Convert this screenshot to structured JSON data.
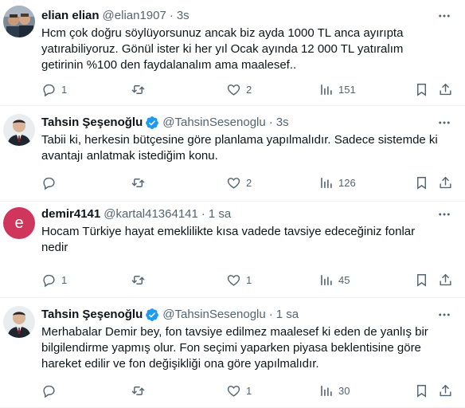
{
  "tweets": [
    {
      "name": "elian elian",
      "handle": "@elian1907",
      "time": "3s",
      "verified": false,
      "lines": [
        "Hcm çok doğru söylüyorsunuz ancak biz ayda 1000 TL anca ayırıpta",
        "yatırabiliyoruz. Gönül ister ki her yıl Ocak ayında 12 000 TL yatıralım",
        "getirinin %100 den faydalanalım ama maalesef.."
      ],
      "replies": "1",
      "retweets": "",
      "likes": "2",
      "views": "151"
    },
    {
      "name": "Tahsin Şeşenoğlu",
      "handle": "@TahsinSesenoglu",
      "time": "3s",
      "verified": true,
      "lines": [
        "Tabii ki, herkesin bütçesine göre planlama yapılmalıdır. Sadece sistemde ki",
        "avantajı anlatmak istediğim konu."
      ],
      "replies": "",
      "retweets": "",
      "likes": "2",
      "views": "126"
    },
    {
      "name": "demir4141",
      "handle": "@kartal41364141",
      "time": "1 sa",
      "verified": false,
      "avatar_letter": "e",
      "lines": [
        "Hocam Türkiye hayat emeklilikte kısa vadede tavsiye edeceğiniz fonlar",
        "nedir"
      ],
      "replies": "1",
      "retweets": "",
      "likes": "1",
      "views": "45"
    },
    {
      "name": "Tahsin Şeşenoğlu",
      "handle": "@TahsinSesenoglu",
      "time": "1 sa",
      "verified": true,
      "lines": [
        "Merhabalar Demir bey, fon tavsiye edilmez maalesef ki eden de yanlış bir",
        "bilgilendirme yapmış olur. Fon seçimi yaparken piyasa beklentisine göre",
        "hareket edilir ve fon değişikliği ona göre yapılmalıdır."
      ],
      "replies": "",
      "retweets": "",
      "likes": "1",
      "views": "30"
    }
  ],
  "separator": "·",
  "colors": {
    "text": "#0f1419",
    "muted": "#536471",
    "verified": "#1d9bf0",
    "letter_avatar": "#d0355b"
  }
}
